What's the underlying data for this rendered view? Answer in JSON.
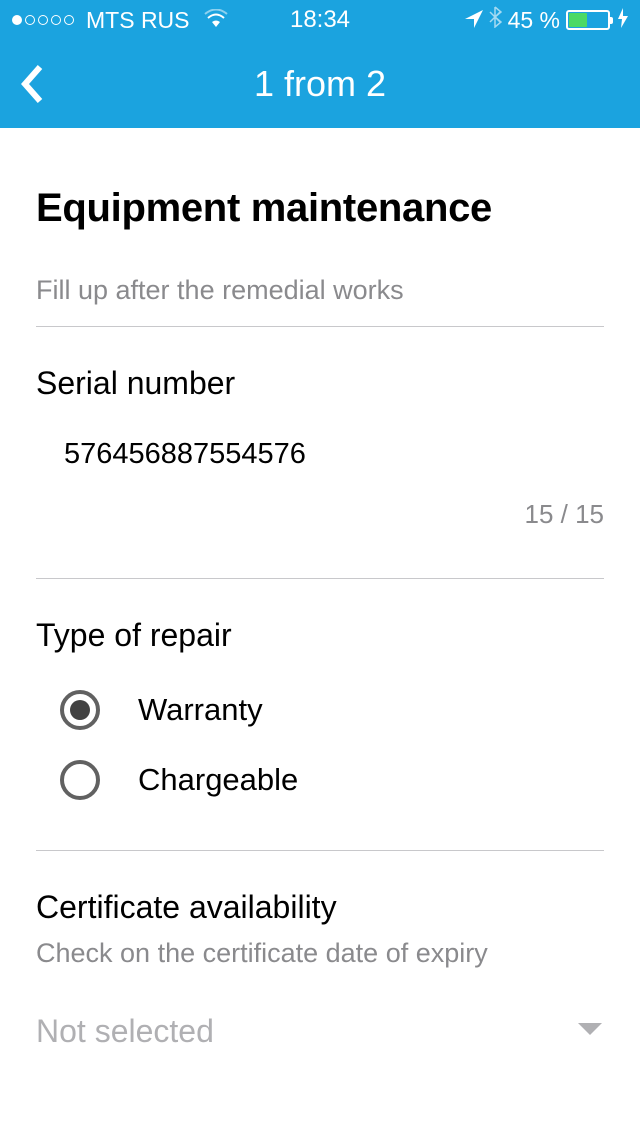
{
  "status_bar": {
    "carrier": "MTS RUS",
    "time": "18:34",
    "battery_percent": "45 %"
  },
  "nav": {
    "title": "1 from 2"
  },
  "page": {
    "title": "Equipment maintenance",
    "description": "Fill up after the remedial works"
  },
  "serial": {
    "label": "Serial number",
    "value": "576456887554576",
    "counter": "15 / 15"
  },
  "repair_type": {
    "label": "Type of repair",
    "options": [
      {
        "label": "Warranty",
        "selected": true
      },
      {
        "label": "Chargeable",
        "selected": false
      }
    ]
  },
  "certificate": {
    "label": "Certificate availability",
    "sublabel": "Check on the certificate date of expiry",
    "selected_value": "Not selected"
  }
}
